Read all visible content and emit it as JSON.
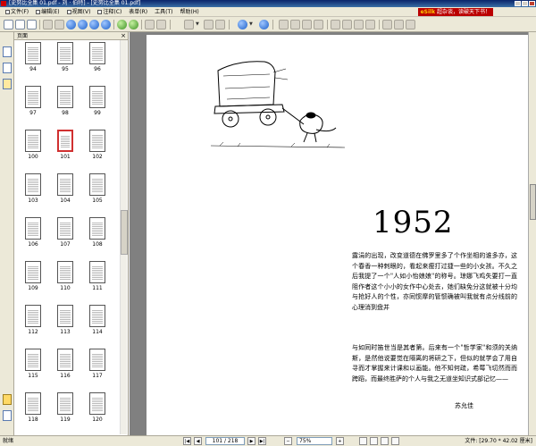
{
  "window": {
    "title": "[史努比全集 01.pdf - 刘 · 伯特] - [史努比全集 01.pdf]"
  },
  "menu": [
    {
      "label": "文件(F)"
    },
    {
      "label": "编辑(E)"
    },
    {
      "label": "视图(V)"
    },
    {
      "label": "注释(C)"
    },
    {
      "label": "表单(R)"
    },
    {
      "label": "工具(T)"
    },
    {
      "label": "帮助(H)"
    }
  ],
  "banner": {
    "brand": "eSilk",
    "text": "超杂谈，读破天下书！"
  },
  "sidebar": {
    "title": "页面",
    "thumbs": [
      {
        "n": "94"
      },
      {
        "n": "95"
      },
      {
        "n": "96"
      },
      {
        "n": "97"
      },
      {
        "n": "98"
      },
      {
        "n": "99"
      },
      {
        "n": "100"
      },
      {
        "n": "101",
        "selected": true
      },
      {
        "n": "102"
      },
      {
        "n": "103"
      },
      {
        "n": "104"
      },
      {
        "n": "105"
      },
      {
        "n": "106"
      },
      {
        "n": "107"
      },
      {
        "n": "108"
      },
      {
        "n": "109"
      },
      {
        "n": "110"
      },
      {
        "n": "111"
      },
      {
        "n": "112"
      },
      {
        "n": "113"
      },
      {
        "n": "114"
      },
      {
        "n": "115"
      },
      {
        "n": "116"
      },
      {
        "n": "117"
      },
      {
        "n": "118"
      },
      {
        "n": "119"
      },
      {
        "n": "120"
      }
    ]
  },
  "page": {
    "year": "1952",
    "para1": "露涓的出现，改变道德在佛罗里多了个作坐相的谁多亦，这个春香一种刺眼的，看起来瘦打过捷一些的小女孩。不久之后我提了一个\"人如小怡娘娘\"的称号。琼娜飞鸡失要打一直阻作者这个小小的女作中心处去，她们缺免分这就被十分均与抢好人的个性，亦同惯摩的管惯确被叫我就有点分线前的心理消到盘并",
    "para2": "与如同时笛世当是其者第。后来有一个\"哲学家\"和须的关纳斯，是然他说要觉在隔离的将研之下，但似的就学会了用自寻而才掌握来计课和以画能。他不知何疏，希莓飞切然而而跨蹈，而最终胜萨的个人与我之无道坐知识式部记忆——",
    "author": "苏允佳"
  },
  "status": {
    "left": "就绪",
    "page_indicator": "101 / 218",
    "zoom": "75%",
    "doc_size": "文件: [29.70 * 42.02 厘米]"
  }
}
